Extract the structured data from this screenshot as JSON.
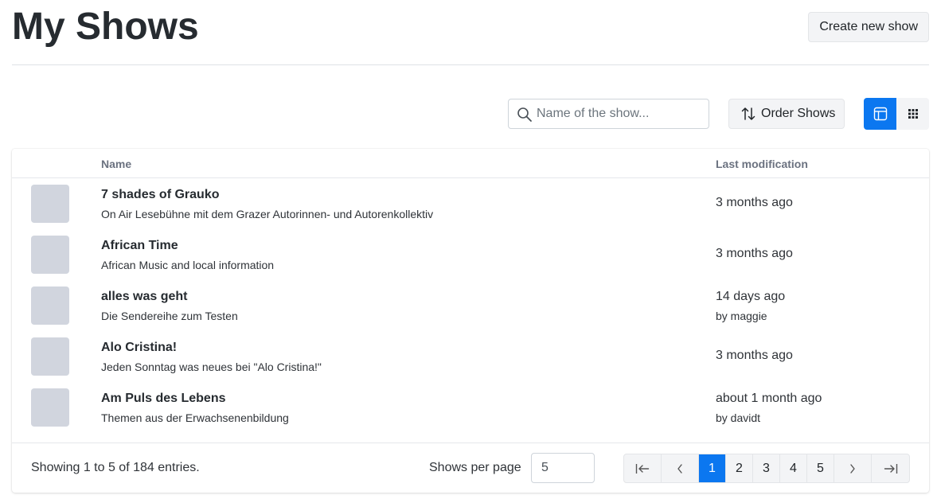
{
  "header": {
    "title": "My Shows",
    "create_label": "Create new show"
  },
  "toolbar": {
    "search_placeholder": "Name of the show...",
    "order_label": "Order Shows",
    "active_view": "list"
  },
  "table": {
    "columns": [
      "Name",
      "Last modification"
    ],
    "rows": [
      {
        "name": "7 shades of Grauko",
        "description": "On Air Lesebühne mit dem Grazer Autorinnen- und Autorenkollektiv",
        "modified": "3 months ago",
        "by": ""
      },
      {
        "name": "African Time",
        "description": "African Music and local information",
        "modified": "3 months ago",
        "by": ""
      },
      {
        "name": "alles was geht",
        "description": "Die Sendereihe zum Testen",
        "modified": "14 days ago",
        "by": "by maggie"
      },
      {
        "name": "Alo Cristina!",
        "description": "Jeden Sonntag was neues bei \"Alo Cristina!\"",
        "modified": "3 months ago",
        "by": ""
      },
      {
        "name": "Am Puls des Lebens",
        "description": "Themen aus der Erwachsenenbildung",
        "modified": "about 1 month ago",
        "by": "by davidt"
      }
    ]
  },
  "footer": {
    "entries_text": "Showing 1 to 5 of 184 entries.",
    "per_page_label": "Shows per page",
    "per_page_value": "5",
    "pages": [
      "1",
      "2",
      "3",
      "4",
      "5"
    ],
    "current_page": "1"
  },
  "colors": {
    "accent": "#0b77f0",
    "thumb_placeholder": "#d1d5de",
    "button_bg": "#f3f4f6"
  }
}
